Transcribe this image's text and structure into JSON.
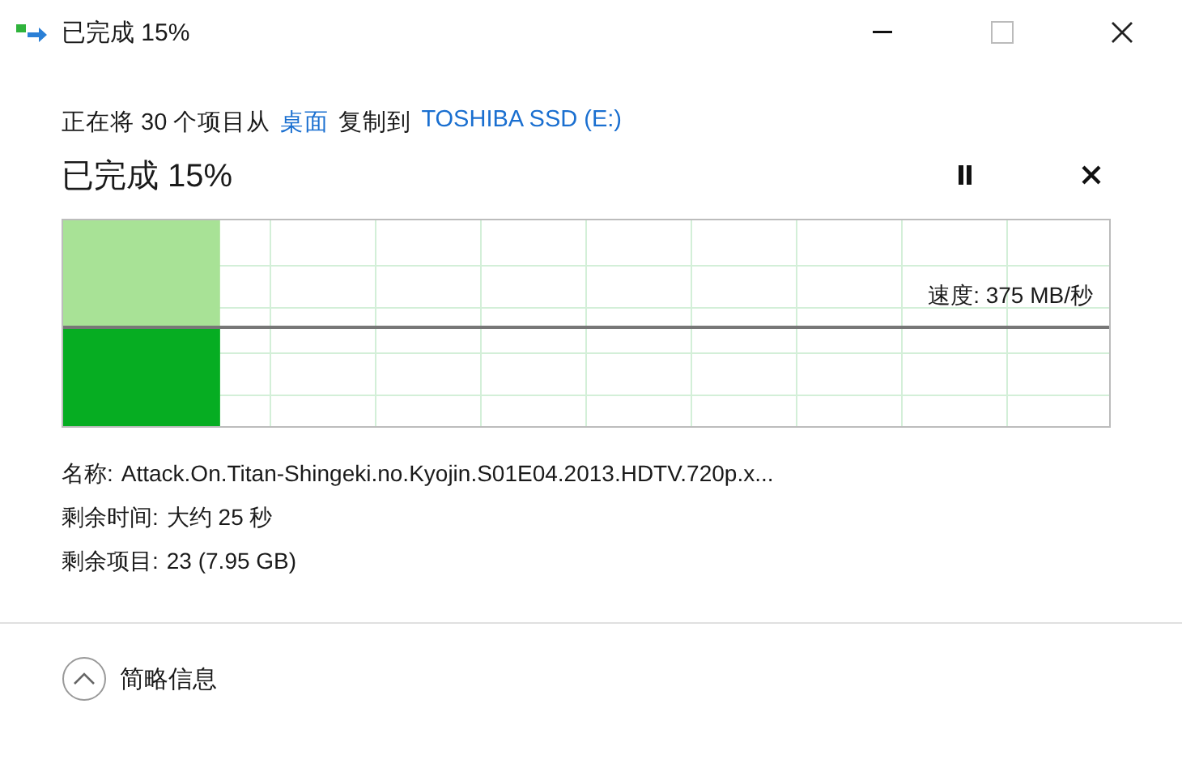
{
  "window": {
    "title": "已完成 15%"
  },
  "header": [
    {
      "kind": "plain",
      "text": "正在将 30 个项目从"
    },
    {
      "kind": "link",
      "text": "桌面"
    },
    {
      "kind": "plain",
      "text": "复制到"
    },
    {
      "kind": "link",
      "text": "TOSHIBA SSD (E:)"
    }
  ],
  "progress": {
    "title": "已完成 15%",
    "level": 0.15,
    "speed": "速度: 375 MB/秒",
    "paused": false
  },
  "details": [
    {
      "label": "名称:",
      "value": "Attack.On.Titan-Shingeki.no.Kyojin.S01E04.2013.HDTV.720p.x..."
    },
    {
      "label": "剩余时间:",
      "value": "大约 25 秒"
    },
    {
      "label": "剩余项目:",
      "value": "23 (7.95 GB)"
    }
  ],
  "footer": {
    "label": "简略信息",
    "expanded": true
  }
}
